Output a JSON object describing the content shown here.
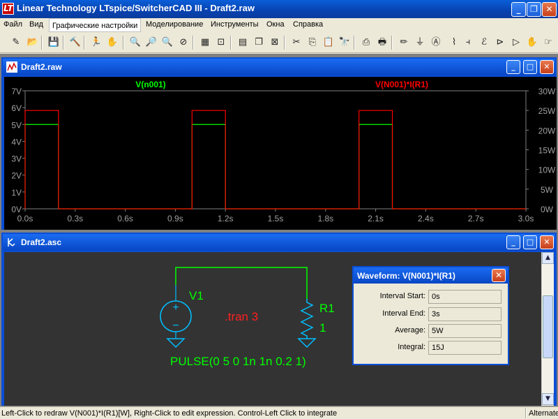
{
  "app": {
    "title": "Linear Technology LTspice/SwitcherCAD III - Draft2.raw",
    "icon": "ltspice-logo-icon",
    "icon_text": "LT"
  },
  "menu": {
    "items": [
      "Файл",
      "Вид",
      "Графические настройки",
      "Моделирование",
      "Инструменты",
      "Окна",
      "Справка"
    ],
    "active_index": 2
  },
  "toolbar": {
    "buttons": [
      {
        "name": "new-schematic-icon",
        "glyph": "✎"
      },
      {
        "name": "open-icon",
        "glyph": "📂"
      },
      {
        "name": "save-icon",
        "glyph": "💾"
      },
      {
        "name": "control-panel-icon",
        "glyph": "🔨"
      },
      {
        "name": "run-icon",
        "glyph": "🏃"
      },
      {
        "name": "halt-icon",
        "glyph": "✋"
      },
      {
        "name": "zoom-in-icon",
        "glyph": "🔍"
      },
      {
        "name": "pan-icon",
        "glyph": "🔎"
      },
      {
        "name": "zoom-out-icon",
        "glyph": "🔍"
      },
      {
        "name": "zoom-cancel-icon",
        "glyph": "⊘"
      },
      {
        "name": "autorange-icon",
        "glyph": "▦"
      },
      {
        "name": "plot-settings-icon",
        "glyph": "⊡"
      },
      {
        "name": "tile-horizontal-icon",
        "glyph": "▤"
      },
      {
        "name": "cascade-icon",
        "glyph": "❐"
      },
      {
        "name": "close-windows-icon",
        "glyph": "⊠"
      },
      {
        "name": "cut-icon",
        "glyph": "✂"
      },
      {
        "name": "copy-icon",
        "glyph": "⎘"
      },
      {
        "name": "paste-icon",
        "glyph": "📋"
      },
      {
        "name": "find-icon",
        "glyph": "🔭"
      },
      {
        "name": "print-setup-icon",
        "glyph": "⎙"
      },
      {
        "name": "print-icon",
        "glyph": "🖶"
      },
      {
        "name": "draw-wire-icon",
        "glyph": "✏"
      },
      {
        "name": "ground-icon",
        "glyph": "⏚"
      },
      {
        "name": "label-net-icon",
        "glyph": "Ⓐ"
      },
      {
        "name": "resistor-icon",
        "glyph": "⌇"
      },
      {
        "name": "capacitor-icon",
        "glyph": "⫞"
      },
      {
        "name": "inductor-icon",
        "glyph": "ℰ"
      },
      {
        "name": "diode-icon",
        "glyph": "⊳"
      },
      {
        "name": "component-icon",
        "glyph": "▷"
      },
      {
        "name": "move-icon",
        "glyph": "✋"
      },
      {
        "name": "drag-icon",
        "glyph": "☞"
      }
    ]
  },
  "plot_window": {
    "title": "Draft2.raw",
    "icon": "waveform-icon",
    "traces": [
      {
        "label": "V(n001)",
        "color": "#00ff00"
      },
      {
        "label": "V(N001)*I(R1)",
        "color": "#ff0000"
      }
    ]
  },
  "chart_data": {
    "type": "line",
    "title": "",
    "xlabel": "",
    "ylabel": "",
    "x_ticks": [
      "0.0s",
      "0.3s",
      "0.6s",
      "0.9s",
      "1.2s",
      "1.5s",
      "1.8s",
      "2.1s",
      "2.4s",
      "2.7s",
      "3.0s"
    ],
    "xlim": [
      0,
      3.0
    ],
    "y_left_ticks": [
      "0V",
      "1V",
      "2V",
      "3V",
      "4V",
      "5V",
      "6V",
      "7V"
    ],
    "ylim_left": [
      0,
      7
    ],
    "y_right_ticks": [
      "0W",
      "5W",
      "10W",
      "15W",
      "20W",
      "25W",
      "30W"
    ],
    "ylim_right": [
      0,
      30
    ],
    "grid": false,
    "series": [
      {
        "name": "V(n001)",
        "axis": "left",
        "color": "#00ff00",
        "x": [
          0,
          0,
          0.2,
          0.2,
          1.0,
          1.0,
          1.2,
          1.2,
          2.0,
          2.0,
          2.2,
          2.2,
          3.0
        ],
        "y": [
          0,
          5,
          5,
          0,
          0,
          5,
          5,
          0,
          0,
          5,
          5,
          0,
          0
        ]
      },
      {
        "name": "V(N001)*I(R1)",
        "axis": "right",
        "color": "#ff0000",
        "x": [
          0,
          0,
          0.2,
          0.2,
          1.0,
          1.0,
          1.2,
          1.2,
          2.0,
          2.0,
          2.2,
          2.2,
          3.0
        ],
        "y": [
          0,
          25,
          25,
          0,
          0,
          25,
          25,
          0,
          0,
          25,
          25,
          0,
          0
        ]
      }
    ]
  },
  "schematic_window": {
    "title": "Draft2.asc",
    "icon": "schematic-icon",
    "source_name": "V1",
    "resistor_name": "R1",
    "resistor_value": "1",
    "directive": ".tran 3",
    "source_value": "PULSE(0 5 0 1n 1n 0.2 1)",
    "wire_color": "#00ff00",
    "component_color": "#00bfff",
    "directive_color": "#ff2020"
  },
  "waveform_dialog": {
    "title": "Waveform: V(N001)*I(R1)",
    "rows": [
      {
        "label": "Interval Start:",
        "value": "0s"
      },
      {
        "label": "Interval End:",
        "value": "3s"
      },
      {
        "label": "Average:",
        "value": "5W"
      },
      {
        "label": "Integral:",
        "value": "15J"
      }
    ]
  },
  "statusbar": {
    "message": "Left-Click to redraw V(N001)*I(R1)[W],  Right-Click to edit expression. Control-Left Click to integrate",
    "mode": "Alternate"
  }
}
